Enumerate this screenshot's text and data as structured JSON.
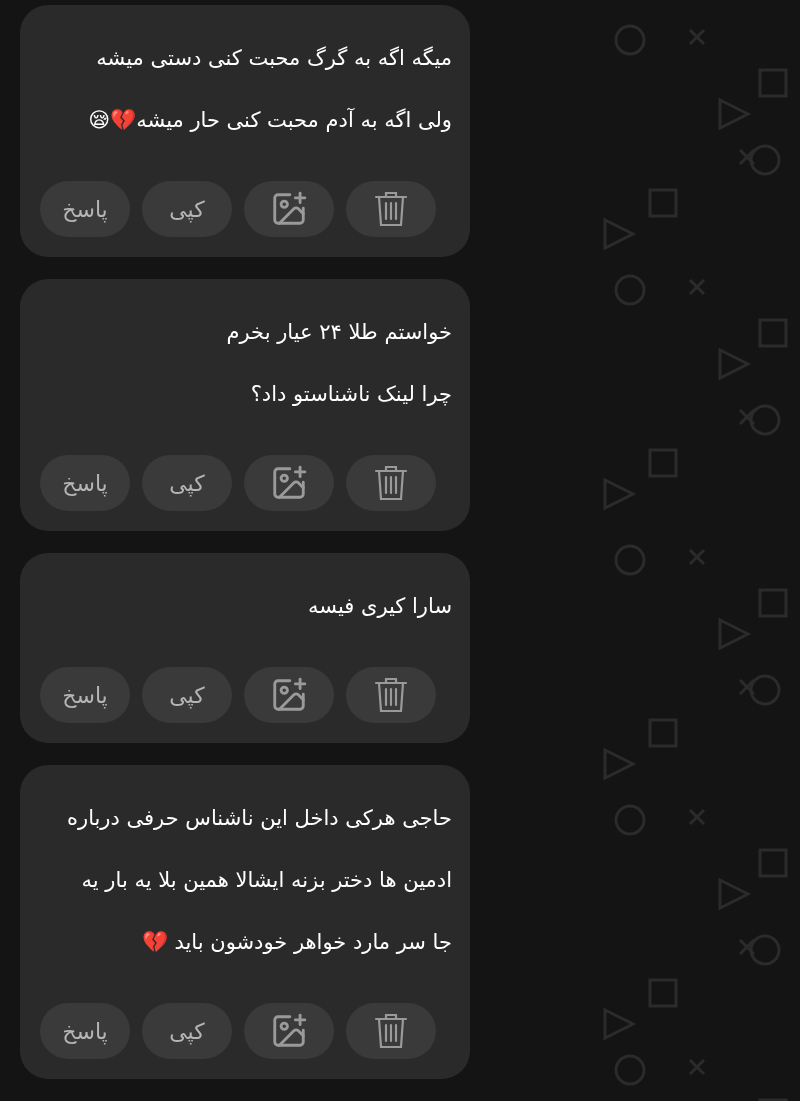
{
  "messages": [
    {
      "lines": [
        "میگه اگه به گرگ محبت کنی دستی میشه",
        "ولی اگه به آدم محبت کنی حار میشه💔😪"
      ],
      "actions": [
        {
          "kind": "delete"
        },
        {
          "kind": "image"
        },
        {
          "kind": "text",
          "label": "کپی"
        },
        {
          "kind": "text",
          "label": "پاسخ"
        }
      ]
    },
    {
      "lines": [
        "خواستم طلا ۲۴ عیار بخرم",
        "چرا لینک ناشناستو داد؟"
      ],
      "actions": [
        {
          "kind": "delete"
        },
        {
          "kind": "image"
        },
        {
          "kind": "text",
          "label": "کپی"
        },
        {
          "kind": "text",
          "label": "پاسخ"
        }
      ]
    },
    {
      "lines": [
        "سارا کیری فیسه"
      ],
      "actions": [
        {
          "kind": "delete"
        },
        {
          "kind": "image"
        },
        {
          "kind": "text",
          "label": "کپی"
        },
        {
          "kind": "text",
          "label": "پاسخ"
        }
      ]
    },
    {
      "lines": [
        "حاجی هرکی داخل این ناشناس حرفی درباره",
        "ادمین ها دختر بزنه ایشالا همین بلا یه بار یه",
        "جا سر مارد خواهر خودشون باید 💔"
      ],
      "actions": [
        {
          "kind": "delete"
        },
        {
          "kind": "image"
        },
        {
          "kind": "text",
          "label": "کپی"
        },
        {
          "kind": "text",
          "label": "پاسخ"
        }
      ]
    }
  ]
}
